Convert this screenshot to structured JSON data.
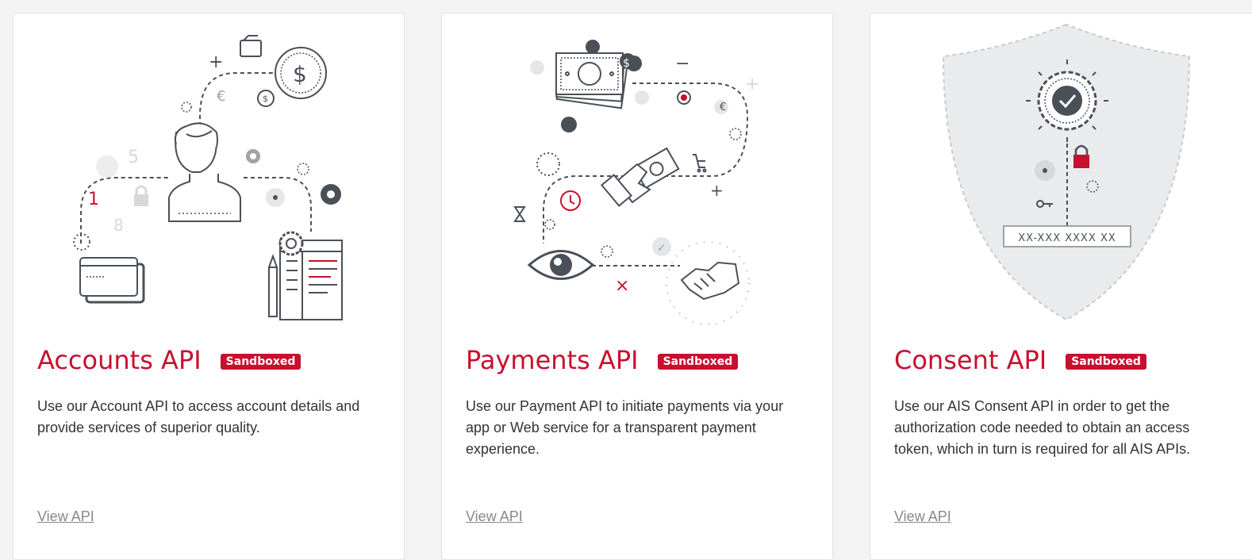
{
  "colors": {
    "accent": "#c8102e",
    "ink": "#4a5058",
    "muted": "#d6d8da"
  },
  "cards": [
    {
      "title": "Accounts API",
      "badge": "Sandboxed",
      "description": "Use our Account API to access account details and provide services of superior quality.",
      "link": "View API",
      "illustration": {
        "icons": [
          "person-icon",
          "wallet-icon",
          "dollar-coin-icon",
          "credit-card-icon",
          "gear-icon",
          "lock-icon",
          "document-icon",
          "pencil-icon"
        ],
        "glyphs": {
          "dollar": "$",
          "dollar_small": "$",
          "euro": "€",
          "one": "1",
          "five": "5",
          "eight": "8",
          "plus": "+"
        }
      }
    },
    {
      "title": "Payments API",
      "badge": "Sandboxed",
      "description": "Use our Payment API to initiate payments via your app or Web service for a transparent payment experience.",
      "link": "View API",
      "illustration": {
        "icons": [
          "banknotes-icon",
          "hand-cash-icon",
          "eye-icon",
          "handshake-icon",
          "clock-icon",
          "hourglass-icon",
          "cart-icon"
        ],
        "glyphs": {
          "dollar": "$",
          "euro": "€",
          "plus": "+",
          "minus": "−",
          "times": "×",
          "check": "✓"
        }
      }
    },
    {
      "title": "Consent API",
      "badge": "Sandboxed",
      "description": "Use our AIS Consent API in order to get the authorization code needed to obtain an access token, which in turn is required for all AIS APIs.",
      "link": "View API",
      "illustration": {
        "icons": [
          "shield-icon",
          "verified-seal-icon",
          "lock-icon",
          "gear-icon",
          "key-icon"
        ],
        "code_text": "XX-XXX XXXX XX"
      }
    }
  ]
}
